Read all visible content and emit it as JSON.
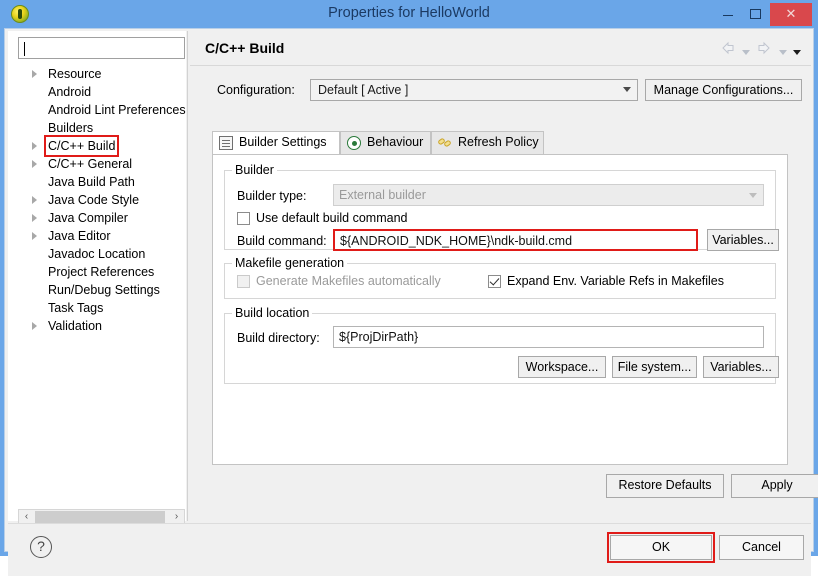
{
  "window": {
    "title": "Properties for HelloWorld",
    "app_icon": "eclipse-icon",
    "minimize_label": "",
    "maximize_label": "",
    "close_label": "✕"
  },
  "sidebar": {
    "filter": {
      "value": "",
      "placeholder": ""
    },
    "items": [
      {
        "label": "Resource",
        "expandable": true,
        "highlighted": false
      },
      {
        "label": "Android",
        "expandable": false,
        "highlighted": false
      },
      {
        "label": "Android Lint Preferences",
        "expandable": false,
        "highlighted": false
      },
      {
        "label": "Builders",
        "expandable": false,
        "highlighted": false
      },
      {
        "label": "C/C++ Build",
        "expandable": true,
        "highlighted": true
      },
      {
        "label": "C/C++ General",
        "expandable": true,
        "highlighted": false
      },
      {
        "label": "Java Build Path",
        "expandable": false,
        "highlighted": false
      },
      {
        "label": "Java Code Style",
        "expandable": true,
        "highlighted": false
      },
      {
        "label": "Java Compiler",
        "expandable": true,
        "highlighted": false
      },
      {
        "label": "Java Editor",
        "expandable": true,
        "highlighted": false
      },
      {
        "label": "Javadoc Location",
        "expandable": false,
        "highlighted": false
      },
      {
        "label": "Project References",
        "expandable": false,
        "highlighted": false
      },
      {
        "label": "Run/Debug Settings",
        "expandable": false,
        "highlighted": false
      },
      {
        "label": "Task Tags",
        "expandable": false,
        "highlighted": false
      },
      {
        "label": "Validation",
        "expandable": true,
        "highlighted": false
      }
    ],
    "scrollbar": {
      "left_arrow": "‹",
      "right_arrow": "›"
    }
  },
  "page": {
    "title": "C/C++ Build",
    "nav": {
      "back_icon": "back-arrow-icon",
      "back_menu_icon": "chevron-down-icon",
      "forward_icon": "forward-arrow-icon",
      "forward_menu_icon": "chevron-down-icon",
      "view_menu_icon": "chevron-down-icon"
    },
    "configuration": {
      "label": "Configuration:",
      "value": "Default  [ Active ]",
      "manage_button": "Manage Configurations..."
    },
    "tabs": [
      {
        "label": "Builder Settings",
        "icon": "list-icon",
        "active": true
      },
      {
        "label": "Behaviour",
        "icon": "target-icon",
        "active": false
      },
      {
        "label": "Refresh Policy",
        "icon": "chain-link-icon",
        "active": false
      }
    ],
    "builder_group": {
      "title": "Builder",
      "builder_type_label": "Builder type:",
      "builder_type_value": "External builder",
      "builder_type_disabled": true,
      "use_default_label": "Use default build command",
      "use_default_checked": false,
      "build_command_label": "Build command:",
      "build_command_value": "${ANDROID_NDK_HOME}\\ndk-build.cmd",
      "build_command_highlighted": true,
      "variables_button": "Variables..."
    },
    "makefile_group": {
      "title": "Makefile generation",
      "generate_label": "Generate Makefiles automatically",
      "generate_checked": false,
      "generate_disabled": true,
      "expand_label": "Expand Env. Variable Refs in Makefiles",
      "expand_checked": true
    },
    "location_group": {
      "title": "Build location",
      "build_dir_label": "Build directory:",
      "build_dir_value": "${ProjDirPath}",
      "workspace_button": "Workspace...",
      "filesystem_button": "File system...",
      "variables_button": "Variables..."
    },
    "restore_defaults_button": "Restore Defaults",
    "apply_button": "Apply"
  },
  "footer": {
    "help_icon": "question-mark-icon",
    "help_glyph": "?",
    "ok_button": "OK",
    "ok_highlighted": true,
    "cancel_button": "Cancel"
  },
  "colors": {
    "title_bar": "#6aa6e8",
    "close_button": "#d9484c",
    "highlight_red": "#e01b18",
    "dialog_background": "#f0f0f0",
    "panel_white": "#ffffff"
  }
}
